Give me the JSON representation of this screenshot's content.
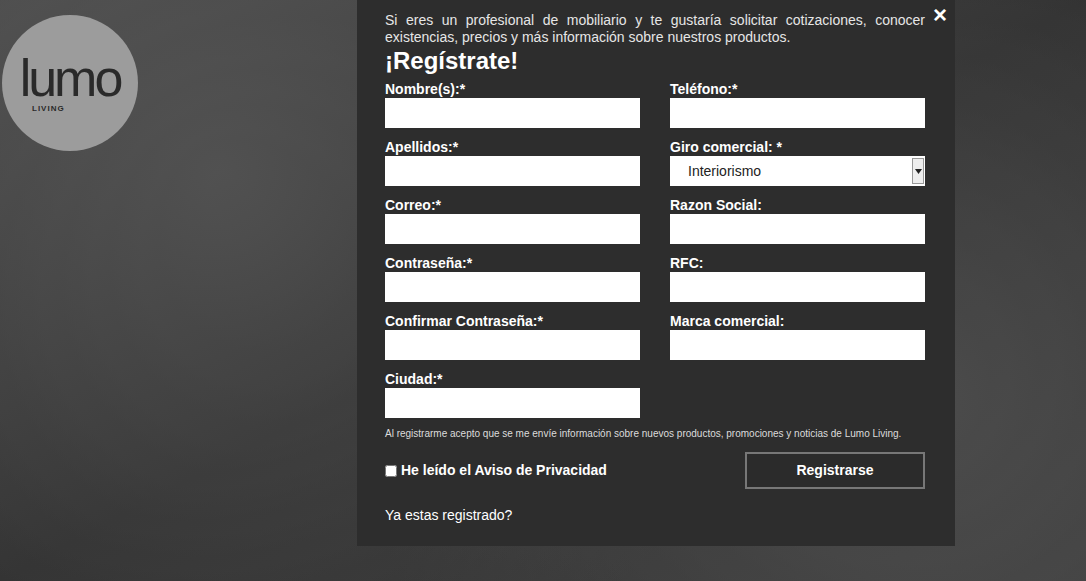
{
  "logo": {
    "mark": "lumo",
    "tagline": "LIVING"
  },
  "modal": {
    "close": "×",
    "intro": "Si eres un profesional de mobiliario y te gustaría solicitar cotizaciones, conocer existencias, precios y más información sobre nuestros productos.",
    "heading": "¡Regístrate!",
    "fields_left": [
      {
        "label": "Nombre(s):*",
        "kind": "text",
        "value": ""
      },
      {
        "label": "Apellidos:*",
        "kind": "text",
        "value": ""
      },
      {
        "label": "Correo:*",
        "kind": "text",
        "value": ""
      },
      {
        "label": "Contraseña:*",
        "kind": "password",
        "value": ""
      },
      {
        "label": "Confirmar Contraseña:*",
        "kind": "password",
        "value": ""
      },
      {
        "label": "Ciudad:*",
        "kind": "text",
        "value": ""
      }
    ],
    "fields_right": [
      {
        "label": "Teléfono:*",
        "kind": "text",
        "value": ""
      },
      {
        "label": "Giro comercial: *",
        "kind": "select",
        "value": "Interiorismo"
      },
      {
        "label": "Razon Social:",
        "kind": "text",
        "value": ""
      },
      {
        "label": "RFC:",
        "kind": "text",
        "value": ""
      },
      {
        "label": "Marca comercial:",
        "kind": "text",
        "value": ""
      }
    ],
    "disclaimer": "Al registrarme acepto que se me envíe información sobre nuevos productos, promociones y noticias de Lumo Living.",
    "privacy": {
      "label": "He leído el Aviso de Privacidad",
      "checked": false
    },
    "submit": "Registrarse",
    "login_link": "Ya estas registrado?"
  }
}
